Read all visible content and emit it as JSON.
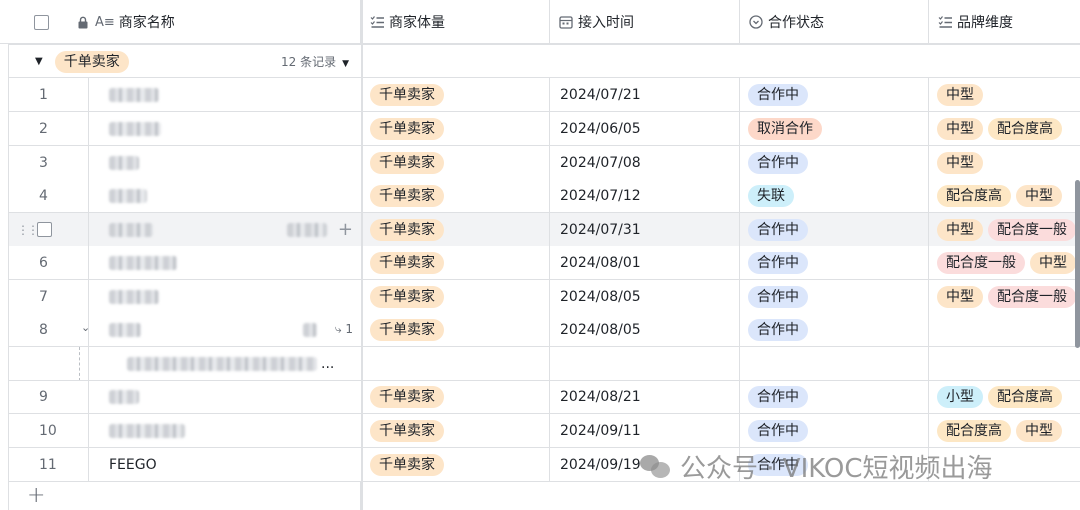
{
  "header": {
    "columns": [
      {
        "label": "商家名称",
        "icon": "text-icon"
      },
      {
        "label": "商家体量",
        "icon": "list-icon"
      },
      {
        "label": "接入时间",
        "icon": "calendar-icon"
      },
      {
        "label": "合作状态",
        "icon": "status-icon"
      },
      {
        "label": "品牌维度",
        "icon": "list-icon"
      }
    ]
  },
  "group": {
    "name": "千单卖家",
    "count": "12 条记录"
  },
  "rows": [
    {
      "num": "1",
      "volume": "千单卖家",
      "time": "2024/07/21",
      "status": "合作中",
      "brand": [
        "中型"
      ]
    },
    {
      "num": "2",
      "volume": "千单卖家",
      "time": "2024/06/05",
      "status": "取消合作",
      "brand": [
        "中型",
        "配合度高"
      ]
    },
    {
      "num": "3",
      "volume": "千单卖家",
      "time": "2024/07/08",
      "status": "合作中",
      "brand": [
        "中型"
      ]
    },
    {
      "num": "4",
      "volume": "千单卖家",
      "time": "2024/07/12",
      "status": "失联",
      "brand": [
        "配合度高",
        "中型"
      ]
    },
    {
      "num": "5",
      "volume": "千单卖家",
      "time": "2024/07/31",
      "status": "合作中",
      "brand": [
        "中型",
        "配合度一般"
      ]
    },
    {
      "num": "6",
      "volume": "千单卖家",
      "time": "2024/08/01",
      "status": "合作中",
      "brand": [
        "配合度一般",
        "中型"
      ]
    },
    {
      "num": "7",
      "volume": "千单卖家",
      "time": "2024/08/05",
      "status": "合作中",
      "brand": [
        "中型",
        "配合度一般"
      ]
    },
    {
      "num": "8",
      "volume": "千单卖家",
      "time": "2024/08/05",
      "status": "合作中",
      "brand": [],
      "subcount": "1"
    },
    {
      "num": "9",
      "volume": "千单卖家",
      "time": "2024/08/21",
      "status": "合作中",
      "brand": [
        "小型",
        "配合度高"
      ]
    },
    {
      "num": "10",
      "volume": "千单卖家",
      "time": "2024/09/11",
      "status": "合作中",
      "brand": [
        "配合度高",
        "中型"
      ]
    },
    {
      "num": "11",
      "name": "FEEGO",
      "volume": "千单卖家",
      "time": "2024/09/19",
      "status": "合作中",
      "brand": []
    }
  ],
  "subrow_ellipsis": "...",
  "watermark": "公众号 · VIKOC短视频出海",
  "colors": {
    "border": "#dee0e3",
    "orange": "#fde5c8",
    "blue": "#dbe6fb",
    "cyan": "#cdeffa",
    "pink": "#fbdcdc"
  }
}
